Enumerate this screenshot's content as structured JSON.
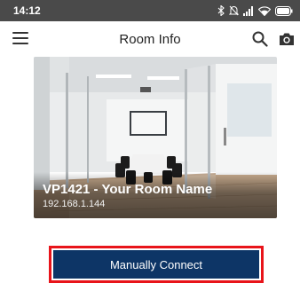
{
  "status_bar": {
    "time": "14:12",
    "icons": [
      "bluetooth-icon",
      "mute-icon",
      "signal-icon",
      "wifi-icon",
      "battery-icon"
    ]
  },
  "header": {
    "title": "Room Info",
    "icons": [
      "menu-icon",
      "search-icon",
      "camera-icon"
    ]
  },
  "room": {
    "name": "VP1421 - Your Room Name",
    "ip": "192.168.1.144"
  },
  "actions": {
    "connect_label": "Manually Connect"
  },
  "colors": {
    "status_bar": "#4a4a4a",
    "button_bg": "#0d3566",
    "highlight": "#e8141a"
  }
}
